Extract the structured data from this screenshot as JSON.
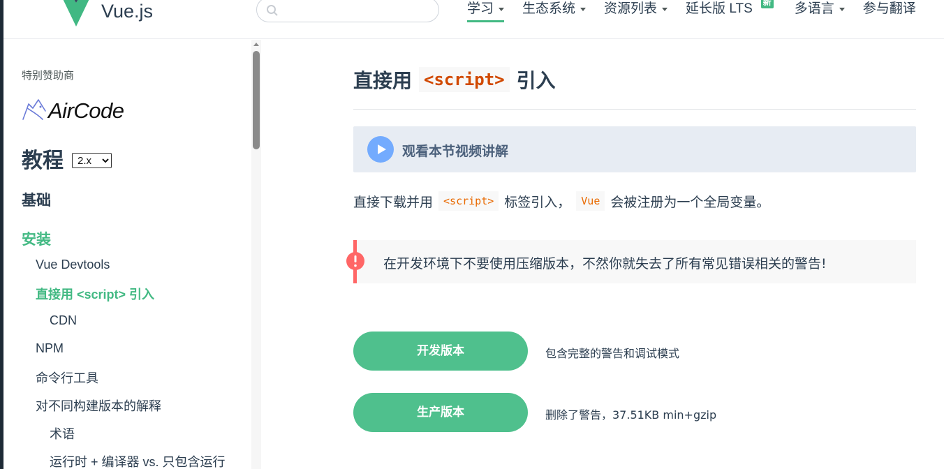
{
  "header": {
    "brand": "Vue.js",
    "search": {
      "placeholder": ""
    },
    "nav": [
      {
        "label": "学习",
        "dropdown": true,
        "active": true
      },
      {
        "label": "生态系统",
        "dropdown": true
      },
      {
        "label": "资源列表",
        "dropdown": true
      },
      {
        "label": "延长版 LTS",
        "badge": "新"
      },
      {
        "label": "多语言",
        "dropdown": true
      },
      {
        "label": "参与翻译"
      }
    ]
  },
  "sidebar": {
    "sponsor_label": "特别赞助商",
    "sponsor_name": "AirCode",
    "tutorial_title": "教程",
    "version": "2.x",
    "section_basics": "基础",
    "section_install": "安装",
    "items": [
      {
        "label": "Vue Devtools"
      },
      {
        "label": "直接用 <script> 引入",
        "active": true
      },
      {
        "label": "CDN"
      },
      {
        "label": "NPM"
      },
      {
        "label": "命令行工具"
      },
      {
        "label": "对不同构建版本的解释"
      },
      {
        "label": "术语"
      },
      {
        "label": "运行时 + 编译器 vs. 只包含运行"
      }
    ]
  },
  "content": {
    "title_before": "直接用",
    "title_code": "<script>",
    "title_after": "引入",
    "video_label": "观看本节视频讲解",
    "para_1": "直接下载并用",
    "para_code_1": "<script>",
    "para_2": "标签引入，",
    "para_code_2": "Vue",
    "para_3": "会被注册为一个全局变量。",
    "warning": "在开发环境下不要使用压缩版本，不然你就失去了所有常见错误相关的警告!",
    "downloads": [
      {
        "button": "开发版本",
        "desc": "包含完整的警告和调试模式"
      },
      {
        "button": "生产版本",
        "desc": "删除了警告，37.51KB min+gzip"
      }
    ]
  },
  "colors": {
    "accent": "#42b983",
    "button": "#4fc08d",
    "warning": "#ff6666",
    "video_bg": "#e7ecf3"
  }
}
